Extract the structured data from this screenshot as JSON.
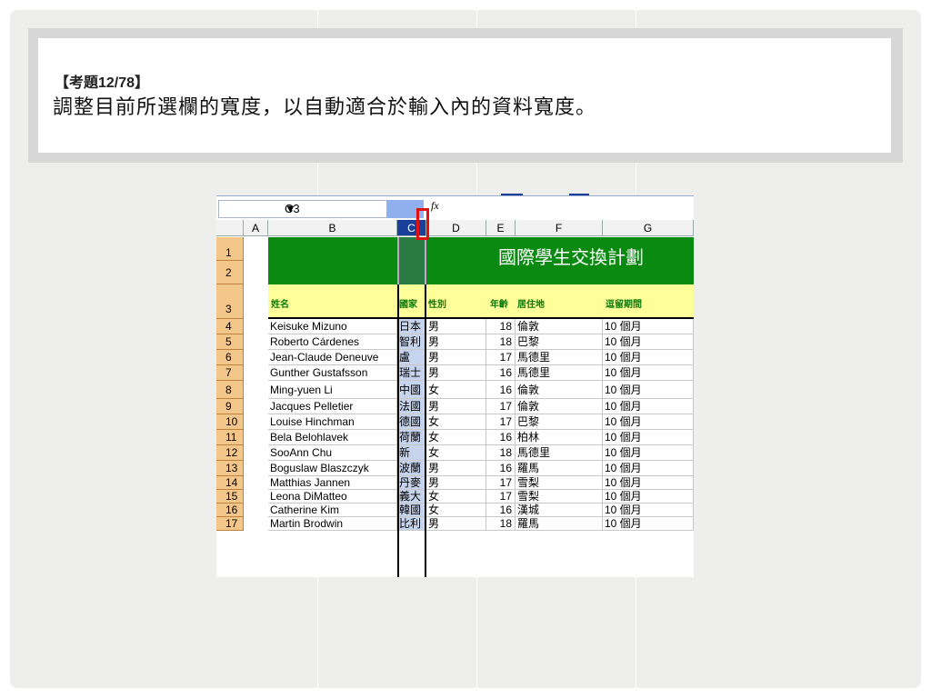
{
  "question": {
    "label": "【考題12/78】",
    "text": "調整目前所選欄的寬度，以自動適合於輸入內的資料寬度。"
  },
  "excel": {
    "name_box": "C3",
    "fx_label": "fx",
    "columns": [
      "A",
      "B",
      "C",
      "D",
      "E",
      "F",
      "G"
    ],
    "row_numbers": [
      "1",
      "2",
      "3",
      "4",
      "5",
      "6",
      "7",
      "8",
      "9",
      "10",
      "11",
      "12",
      "13",
      "14",
      "15",
      "16",
      "17"
    ],
    "sheet_title": "國際學生交換計劃",
    "headers": {
      "name": "姓名",
      "country": "國家",
      "gender": "性別",
      "age": "年齡",
      "residence": "居住地",
      "stay": "逗留期間"
    },
    "rows": [
      [
        "Keisuke Mizuno",
        "日本",
        "男",
        "18",
        "倫敦",
        "10 個月"
      ],
      [
        "Roberto Cárdenes",
        "智利",
        "男",
        "18",
        "巴黎",
        "10 個月"
      ],
      [
        "Jean-Claude Deneuve",
        "盧",
        "男",
        "17",
        "馬德里",
        "10 個月"
      ],
      [
        "Gunther Gustafsson",
        "瑞士",
        "男",
        "16",
        "馬德里",
        "10 個月"
      ],
      [
        "Ming-yuen Li",
        "中國",
        "女",
        "16",
        "倫敦",
        "10 個月"
      ],
      [
        "Jacques Pelletier",
        "法國",
        "男",
        "17",
        "倫敦",
        "10 個月"
      ],
      [
        "Louise Hinchman",
        "德國",
        "女",
        "17",
        "巴黎",
        "10 個月"
      ],
      [
        "Bela Belohlavek",
        "荷蘭",
        "女",
        "16",
        "柏林",
        "10 個月"
      ],
      [
        "SooAnn Chu",
        "新",
        "女",
        "18",
        "馬德里",
        "10 個月"
      ],
      [
        "Boguslaw Blaszczyk",
        "波蘭",
        "男",
        "16",
        "羅馬",
        "10 個月"
      ],
      [
        "Matthias Jannen",
        "丹麥",
        "男",
        "17",
        "雪梨",
        "10 個月"
      ],
      [
        "Leona DiMatteo",
        "義大",
        "女",
        "17",
        "雪梨",
        "10 個月"
      ],
      [
        "Catherine Kim",
        "韓國",
        "女",
        "16",
        "漢城",
        "10 個月"
      ],
      [
        "Martin Brodwin",
        "比利",
        "男",
        "18",
        "羅馬",
        "10 個月"
      ]
    ],
    "colors": {
      "title_green": "#0b8a12",
      "header_yellow": "#ffff99",
      "row_header_orange": "#f3c68a",
      "highlight_red": "#e01010"
    }
  }
}
